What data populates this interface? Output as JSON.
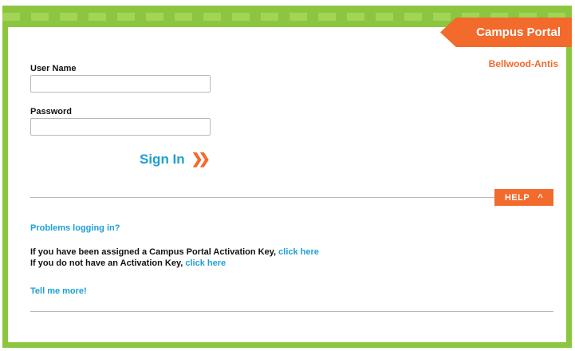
{
  "header": {
    "portal_title": "Campus Portal",
    "district_name": "Bellwood-Antis"
  },
  "login": {
    "username_label": "User Name",
    "username_value": "",
    "password_label": "Password",
    "password_value": "",
    "signin_label": "Sign In",
    "signin_icon": "double-chevron-right-icon"
  },
  "help": {
    "button_label": "HELP",
    "button_icon": "chevron-up-icon",
    "problems_link": "Problems logging in?",
    "activation_assigned_text": "If you have been assigned a Campus Portal Activation Key,",
    "activation_assigned_link": "click here",
    "activation_none_text": "If you do not have an Activation Key,",
    "activation_none_link": "click here",
    "tell_more_link": "Tell me more!"
  },
  "colors": {
    "brand_green": "#8cc63f",
    "accent_orange": "#f26a2c",
    "link_blue": "#1e9fd6"
  }
}
